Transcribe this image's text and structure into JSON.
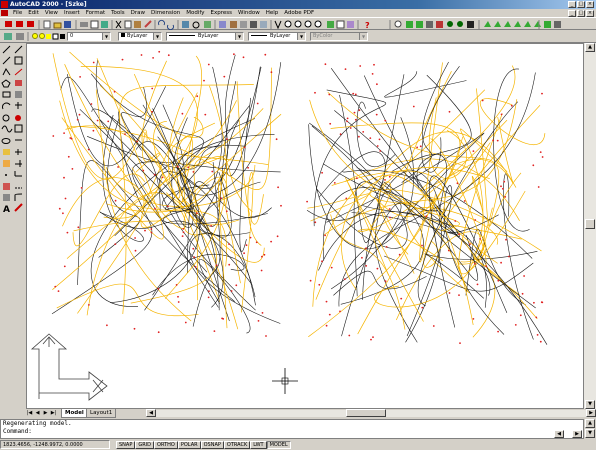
{
  "window": {
    "title": "AutoCAD 2000 - [Szke]",
    "min": "_",
    "max": "□",
    "close": "×"
  },
  "menu": [
    "File",
    "Edit",
    "View",
    "Insert",
    "Format",
    "Tools",
    "Draw",
    "Dimension",
    "Modify",
    "Express",
    "Window",
    "Help",
    "Adobe PDF"
  ],
  "layer_bar": {
    "layer_value": "0",
    "color_value": "ByLayer",
    "linetype_value": "ByLayer",
    "lineweight_value": "ByLayer",
    "plotstyle_value": "ByColor"
  },
  "tabs": {
    "model": "Model",
    "layout1": "Layout1"
  },
  "command": {
    "line1": "Regenerating model.",
    "line2": "Command:"
  },
  "status": {
    "coords": "1823.4656, -1248.9972, 0.0000",
    "buttons": [
      "SNAP",
      "GRID",
      "ORTHO",
      "POLAR",
      "OSNAP",
      "OTRACK",
      "LWT",
      "MODEL"
    ]
  },
  "colors": {
    "drawing_dark": "#1a1a1a",
    "drawing_yellow": "#f5b400",
    "points": "#e02020"
  }
}
